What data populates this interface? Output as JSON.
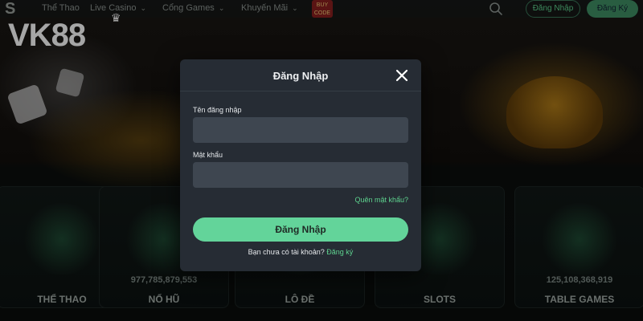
{
  "nav": {
    "items": [
      {
        "label": "Thể Thao",
        "has_chevron": false
      },
      {
        "label": "Live Casino",
        "has_chevron": true
      },
      {
        "label": "Cổng Games",
        "has_chevron": true
      },
      {
        "label": "Khuyến Mãi",
        "has_chevron": true
      }
    ],
    "badge_text": "BUY CODE",
    "login_label": "Đăng Nhập",
    "register_label": "Đăng Ký",
    "search_icon": "search-icon"
  },
  "brand": {
    "vk": "VK",
    "num": "88"
  },
  "categories": [
    {
      "title": "THỂ THAO",
      "count": ""
    },
    {
      "title": "NỔ HŨ",
      "count": "977,785,879,553"
    },
    {
      "title": "LÔ ĐỀ",
      "count": ""
    },
    {
      "title": "SLOTS",
      "count": ""
    },
    {
      "title": "TABLE GAMES",
      "count": "125,108,368,919"
    }
  ],
  "modal": {
    "title": "Đăng Nhập",
    "username_label": "Tên đăng nhập",
    "username_value": "",
    "password_label": "Mật khẩu",
    "password_value": "",
    "forgot_label": "Quên mật khẩu?",
    "submit_label": "Đăng Nhập",
    "no_account_text": "Bạn chưa có tài khoản?",
    "signup_label": "Đăng ký",
    "close_icon": "close-icon"
  },
  "colors": {
    "accent": "#63d49a",
    "link": "#5ed38f",
    "modal_bg": "#262c34",
    "input_bg": "#3e4650"
  }
}
